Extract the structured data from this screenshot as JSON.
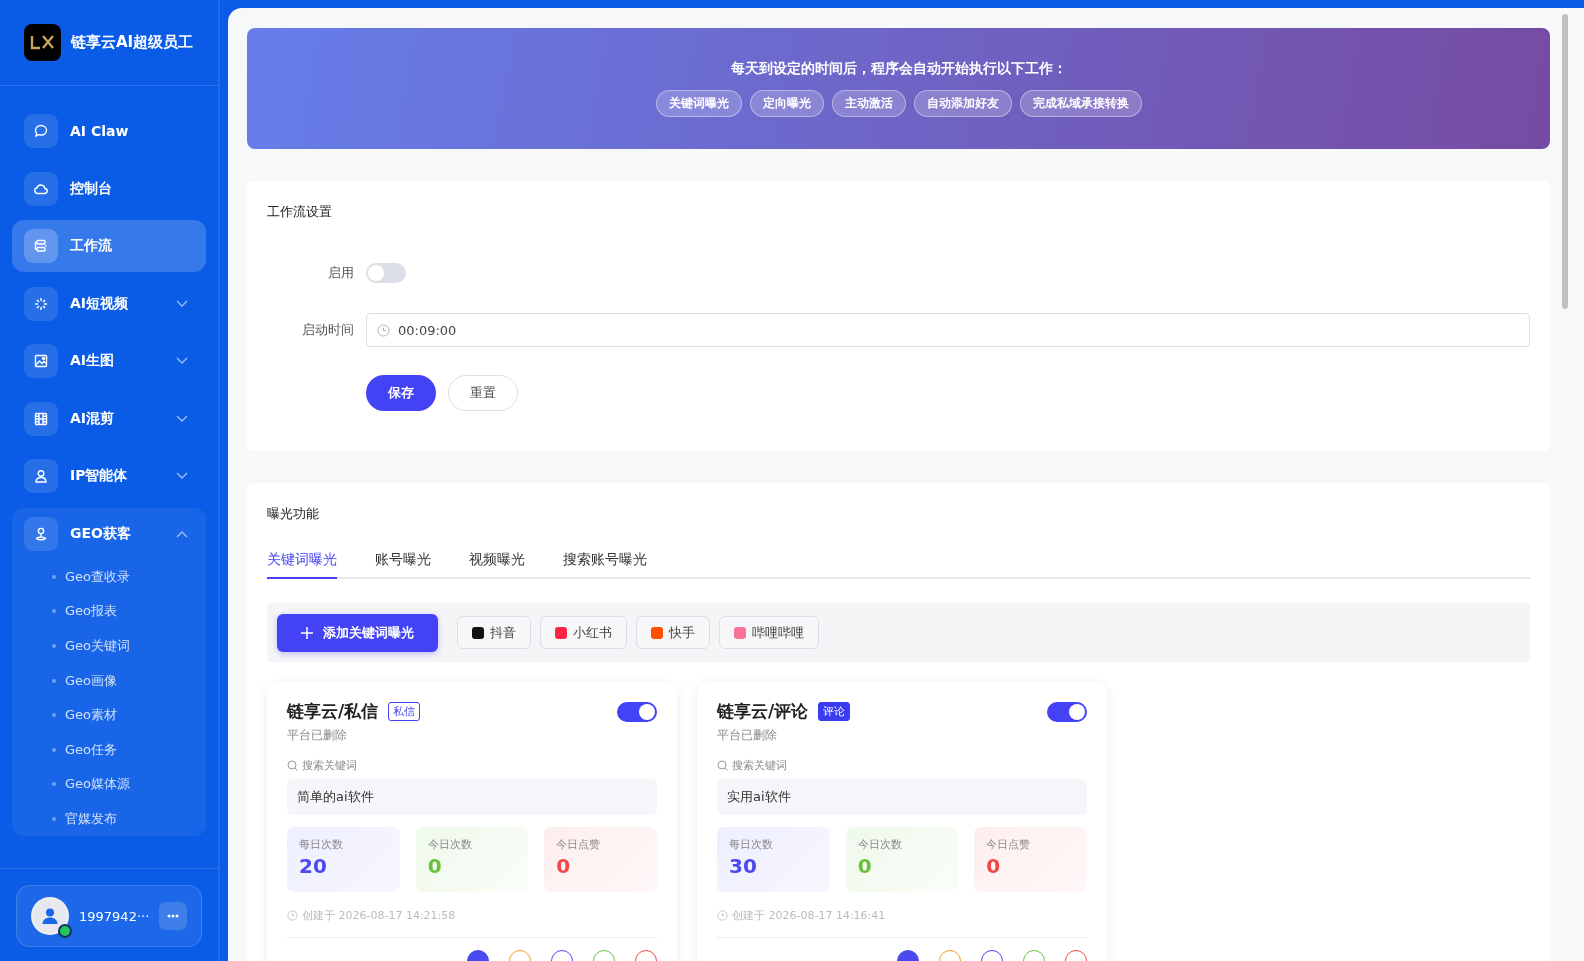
{
  "sidebar": {
    "brand": "链享云AI超级员工",
    "items": [
      {
        "label": "AI Claw",
        "selected": false
      },
      {
        "label": "控制台",
        "selected": false
      },
      {
        "label": "工作流",
        "selected": true
      },
      {
        "label": "AI短视频",
        "selected": false,
        "expanded": false
      },
      {
        "label": "AI生图",
        "selected": false,
        "expanded": false
      },
      {
        "label": "AI混剪",
        "selected": false,
        "expanded": false
      },
      {
        "label": "IP智能体",
        "selected": false,
        "expanded": false
      },
      {
        "label": "GEO获客",
        "selected": false,
        "expanded": true,
        "children": [
          "Geo查收录",
          "Geo报表",
          "Geo关键词",
          "Geo画像",
          "Geo素材",
          "Geo任务",
          "Geo媒体源",
          "官媒发布"
        ]
      }
    ],
    "user": {
      "name": "1997942···",
      "online": true
    }
  },
  "banner": {
    "title": "每天到设定的时间后，程序会自动开始执行以下工作：",
    "steps": [
      "关键词曝光",
      "定向曝光",
      "主动激活",
      "自动添加好友",
      "完成私域承接转换"
    ]
  },
  "workflow": {
    "title": "工作流设置",
    "enable_label": "启用",
    "enabled": false,
    "time_label": "启动时间",
    "time": "00:09:00",
    "save": "保存",
    "reset": "重置"
  },
  "exposure": {
    "title": "曝光功能",
    "tabs": [
      {
        "label": "关键词曝光",
        "selected": true
      },
      {
        "label": "账号曝光",
        "selected": false
      },
      {
        "label": "视频曝光",
        "selected": false
      },
      {
        "label": "搜索账号曝光",
        "selected": false
      }
    ],
    "add_button": "添加关键词曝光",
    "platforms": [
      "抖音",
      "小红书",
      "快手",
      "哔哩哔哩"
    ],
    "cards": [
      {
        "title": "链享云/私信",
        "tag": "私信",
        "kind": "outline",
        "on": true,
        "status": "平台已删除",
        "search_label": "搜索关键词",
        "keyword": "简单的ai软件",
        "stats": [
          {
            "label": "每日次数",
            "value": "20"
          },
          {
            "label": "今日次数",
            "value": "0"
          },
          {
            "label": "今日点赞",
            "value": "0"
          }
        ],
        "created": "创建于 2026-08-17 14:21:58"
      },
      {
        "title": "链享云/评论",
        "tag": "评论",
        "kind": "filled",
        "on": true,
        "status": "平台已删除",
        "search_label": "搜索关键词",
        "keyword": "实用ai软件",
        "stats": [
          {
            "label": "每日次数",
            "value": "30"
          },
          {
            "label": "今日次数",
            "value": "0"
          },
          {
            "label": "今日点赞",
            "value": "0"
          }
        ],
        "created": "创建于 2026-08-17 14:16:41"
      }
    ]
  }
}
